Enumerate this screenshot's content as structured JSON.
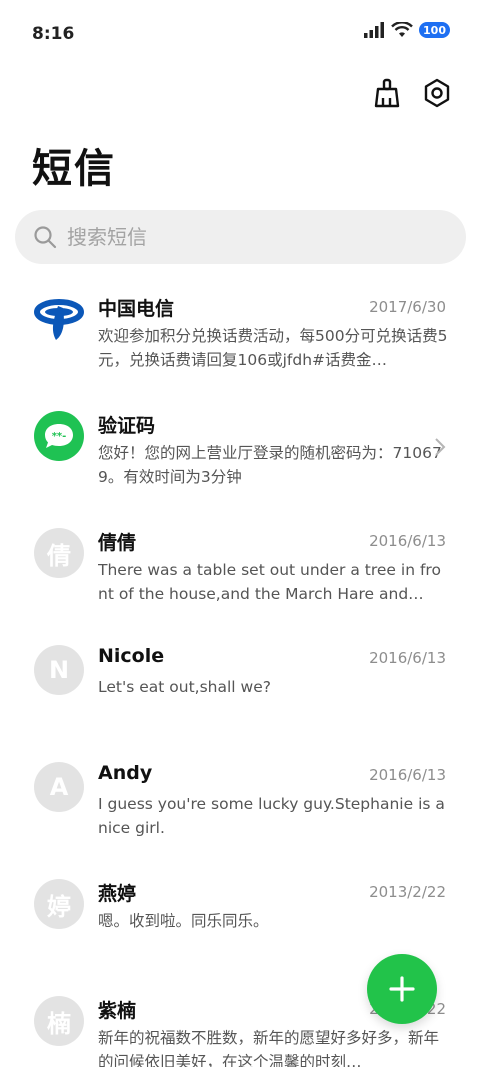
{
  "status_bar": {
    "time": "8:16",
    "battery": "100"
  },
  "toolbar": {
    "clean_icon": "broom-icon",
    "settings_icon": "settings-icon"
  },
  "page": {
    "title": "短信"
  },
  "search": {
    "placeholder": "搜索短信"
  },
  "colors": {
    "accent": "#22c34a",
    "search_bg": "#efefef",
    "avatar_grey": "#e3e3e3",
    "telecom_blue": "#0b57b8"
  },
  "messages": [
    {
      "name": "中国电信",
      "date": "2017/6/30",
      "preview": "欢迎参加积分兑换话费活动，每500分可兑换话费5元，兑换话费请回复106或jfdh#话费金…",
      "avatar": "telecom"
    },
    {
      "name": "验证码",
      "date": "",
      "preview": "您好！您的网上营业厅登录的随机密码为：710679。有效时间为3分钟",
      "avatar": "code"
    },
    {
      "name": "倩倩",
      "date": "2016/6/13",
      "preview": "There was a table set out under a tree in front of the house,and the March Hare and…",
      "avatar": "倩"
    },
    {
      "name": "Nicole",
      "date": "2016/6/13",
      "preview": "Let's eat out,shall we?",
      "avatar": "N"
    },
    {
      "name": "Andy",
      "date": "2016/6/13",
      "preview": "I guess you're some lucky guy.Stephanie is a nice girl.",
      "avatar": "A"
    },
    {
      "name": "燕婷",
      "date": "2013/2/22",
      "preview": "嗯。收到啦。同乐同乐。",
      "avatar": "婷"
    },
    {
      "name": "紫楠",
      "date": "2013/2/22",
      "preview": "新年的祝福数不胜数，新年的愿望好多好多，新年的问候依旧美好，在这个温馨的时刻…",
      "avatar": "楠"
    }
  ]
}
